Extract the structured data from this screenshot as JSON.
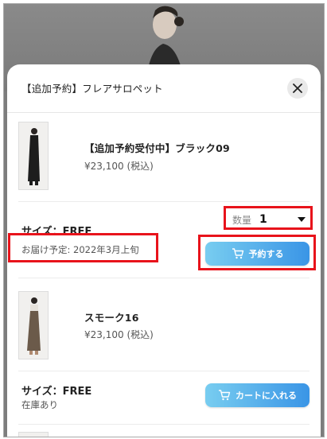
{
  "sheet": {
    "title": "【追加予約】フレアサロペット",
    "close_icon": "close-icon"
  },
  "products": [
    {
      "name": "【追加予約受付中】ブラック09",
      "price": "¥23,100 (税込)",
      "size": "サイズ：FREE",
      "delivery": "お届け予定: 2022年3月上旬",
      "quantity_label": "数量",
      "quantity_value": "1",
      "button_label": "予約する"
    },
    {
      "name": "スモーク16",
      "price": "¥23,100 (税込)",
      "size": "サイズ：FREE",
      "stock": "在庫あり",
      "button_label": "カートに入れる"
    }
  ],
  "colors": {
    "button_gradient_start": "#78cdf0",
    "button_gradient_end": "#3a95e6",
    "highlight": "#e8131b"
  }
}
